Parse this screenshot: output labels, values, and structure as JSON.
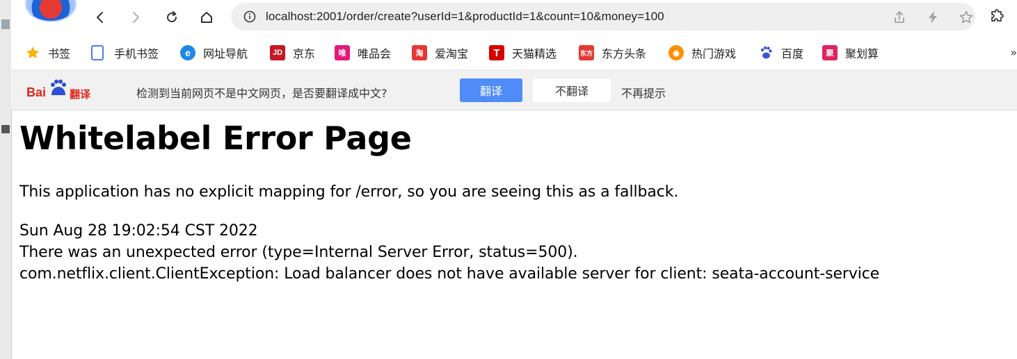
{
  "toolbar": {
    "url": "localhost:2001/order/create?userId=1&productId=1&count=10&money=100"
  },
  "bookmarks": [
    {
      "label": "书签",
      "icon": "star-icon",
      "color": "#f4b400"
    },
    {
      "label": "手机书签",
      "icon": "mobile-bookmark-icon",
      "color": "#4a7cf0"
    },
    {
      "label": "网址导航",
      "icon": "ie-icon",
      "color": "#1e88e5"
    },
    {
      "label": "京东",
      "icon": "jd-icon",
      "color": "#c91623"
    },
    {
      "label": "唯品会",
      "icon": "vip-icon",
      "color": "#e6187a"
    },
    {
      "label": "爱淘宝",
      "icon": "taobao-icon",
      "color": "#e53935"
    },
    {
      "label": "天猫精选",
      "icon": "tmall-icon",
      "color": "#d50000"
    },
    {
      "label": "东方头条",
      "icon": "dftt-icon",
      "color": "#e53935"
    },
    {
      "label": "热门游戏",
      "icon": "game-icon",
      "color": "#ff8f00"
    },
    {
      "label": "百度",
      "icon": "baidu-paw-icon",
      "color": "#3a56d4"
    },
    {
      "label": "聚划算",
      "icon": "juhuasuan-icon",
      "color": "#e0245e"
    }
  ],
  "bookmarks_more": "»",
  "translate_bar": {
    "logo_bai": "Bai",
    "logo_fanyi": "翻译",
    "prompt": "检测到当前网页不是中文网页，是否要翻译成中文?",
    "translate_label": "翻译",
    "no_translate_label": "不翻译",
    "no_more_label": "不再提示"
  },
  "page": {
    "title": "Whitelabel Error Page",
    "fallback_message": "This application has no explicit mapping for /error, so you are seeing this as a fallback.",
    "timestamp": "Sun Aug 28 19:02:54 CST 2022",
    "error_line": "There was an unexpected error (type=Internal Server Error, status=500).",
    "exception_line": "com.netflix.client.ClientException: Load balancer does not have available server for client: seata-account-service"
  }
}
